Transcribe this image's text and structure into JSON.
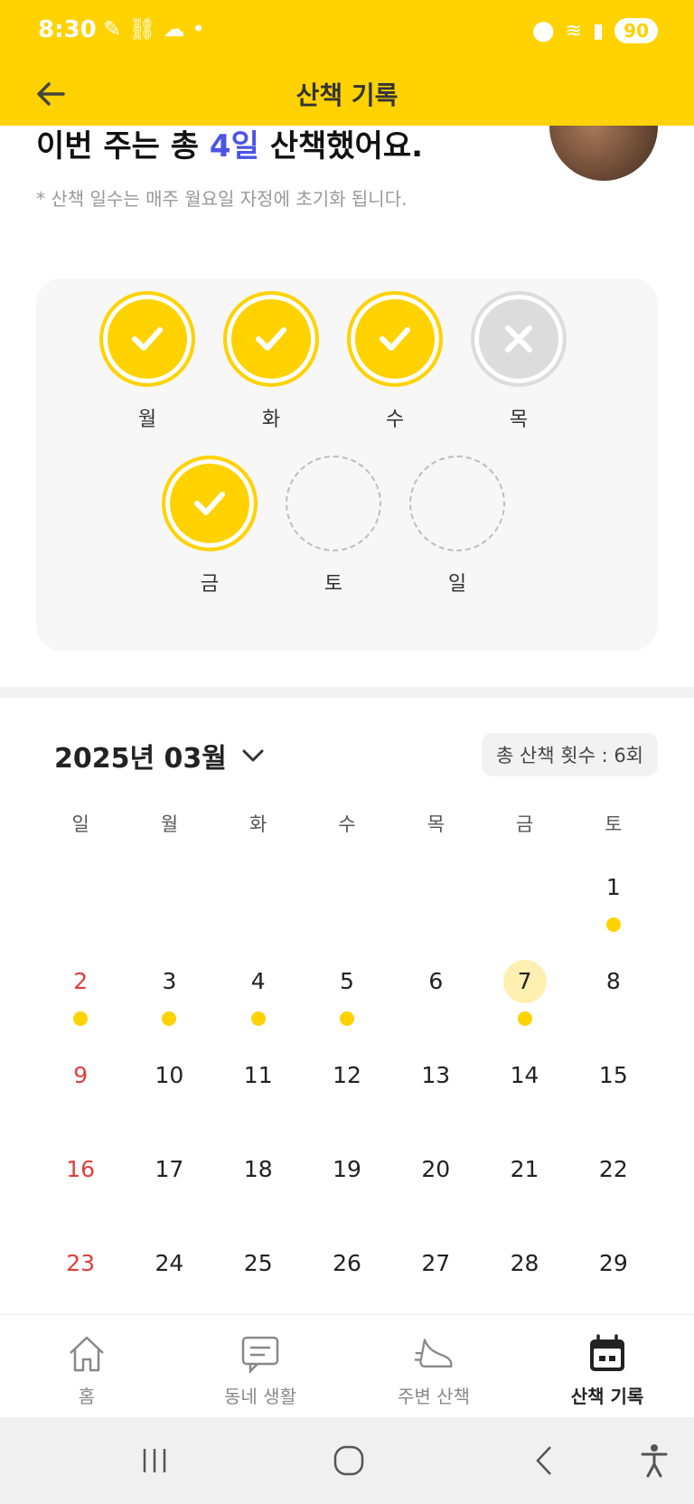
{
  "status_bar": {
    "time": "8:30",
    "battery": "90"
  },
  "header": {
    "title": "산책 기록",
    "back_icon": "arrow-left-icon"
  },
  "summary": {
    "prefix": "이번 주는 총 ",
    "highlight": "4일",
    "suffix": " 산책했어요.",
    "note": "* 산책 일수는 매주 월요일 자정에 초기화 됩니다."
  },
  "week": {
    "days": [
      {
        "label": "월",
        "state": "done"
      },
      {
        "label": "화",
        "state": "done"
      },
      {
        "label": "수",
        "state": "done"
      },
      {
        "label": "목",
        "state": "missed"
      },
      {
        "label": "금",
        "state": "done"
      },
      {
        "label": "토",
        "state": "upcoming"
      },
      {
        "label": "일",
        "state": "upcoming"
      }
    ]
  },
  "calendar": {
    "month_label": "2025년 03월",
    "total_label": "총 산책 횟수 : 6회",
    "weekdays": [
      "일",
      "월",
      "화",
      "수",
      "목",
      "금",
      "토"
    ],
    "weeks": [
      [
        null,
        null,
        null,
        null,
        null,
        null,
        "1"
      ],
      [
        "2",
        "3",
        "4",
        "5",
        "6",
        "7",
        "8"
      ],
      [
        "9",
        "10",
        "11",
        "12",
        "13",
        "14",
        "15"
      ],
      [
        "16",
        "17",
        "18",
        "19",
        "20",
        "21",
        "22"
      ],
      [
        "23",
        "24",
        "25",
        "26",
        "27",
        "28",
        "29"
      ]
    ],
    "walked_days": [
      "1",
      "2",
      "3",
      "4",
      "5",
      "7"
    ],
    "today": "7",
    "colors": {
      "accent": "#FFD200",
      "sunday": "#E03E3E",
      "today_bg": "#FFEFB0"
    }
  },
  "bottom_nav": {
    "items": [
      {
        "label": "홈",
        "icon": "home-icon",
        "active": false
      },
      {
        "label": "동네 생활",
        "icon": "chat-icon",
        "active": false
      },
      {
        "label": "주변 산책",
        "icon": "sneaker-icon",
        "active": false
      },
      {
        "label": "산책 기록",
        "icon": "calendar-icon",
        "active": true
      }
    ]
  }
}
